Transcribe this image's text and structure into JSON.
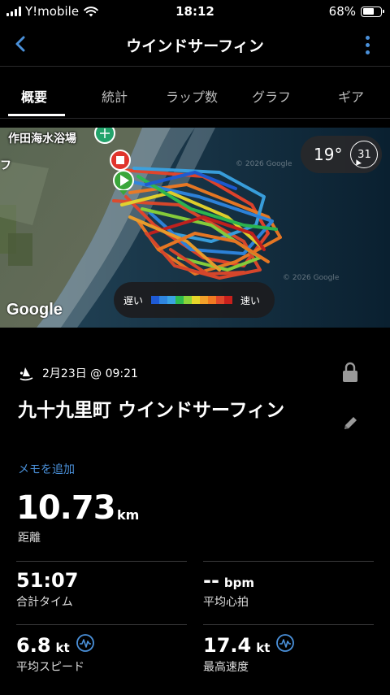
{
  "status_bar": {
    "carrier": "Y!mobile",
    "time": "18:12",
    "battery": "68%",
    "battery_level": 0.68
  },
  "nav": {
    "title": "ウインドサーフィン",
    "back_icon": "chevron-left-icon",
    "more_icon": "more-vertical-icon"
  },
  "tabs": [
    {
      "label": "概要",
      "active": true
    },
    {
      "label": "統計",
      "active": false
    },
    {
      "label": "ラップ数",
      "active": false
    },
    {
      "label": "グラフ",
      "active": false
    },
    {
      "label": "ギア",
      "active": false
    }
  ],
  "map": {
    "place_label": "作田海水浴場",
    "partial_label": "フ",
    "temperature": "19°",
    "wind_speed": "31",
    "google_logo": "Google",
    "copyright_1": "© 2026 Google",
    "copyright_2": "© 2026 Google",
    "legend_slow": "遅い",
    "legend_fast": "速い",
    "legend_colors": [
      "#1e5bd6",
      "#2f86e0",
      "#3aa3e3",
      "#2dbb4f",
      "#8bd43a",
      "#e8d62a",
      "#f2a12a",
      "#f07a22",
      "#e0482a",
      "#c8201c"
    ]
  },
  "activity": {
    "date": "2月23日 @ 09:21",
    "title": "九十九里町 ウインドサーフィン",
    "add_memo": "メモを追加",
    "distance_value": "10.73",
    "distance_unit": "km",
    "distance_label": "距離"
  },
  "stats": {
    "total_time": {
      "value": "51:07",
      "label": "合計タイム"
    },
    "avg_hr": {
      "value": "--",
      "unit": "bpm",
      "label": "平均心拍"
    },
    "avg_speed": {
      "value": "6.8",
      "unit": "kt",
      "label": "平均スピード"
    },
    "max_speed": {
      "value": "17.4",
      "unit": "kt",
      "label": "最高速度"
    }
  },
  "colors": {
    "accent": "#4a90d9",
    "background": "#000000",
    "start_marker": "#3aa63a",
    "end_marker": "#e0342c"
  }
}
